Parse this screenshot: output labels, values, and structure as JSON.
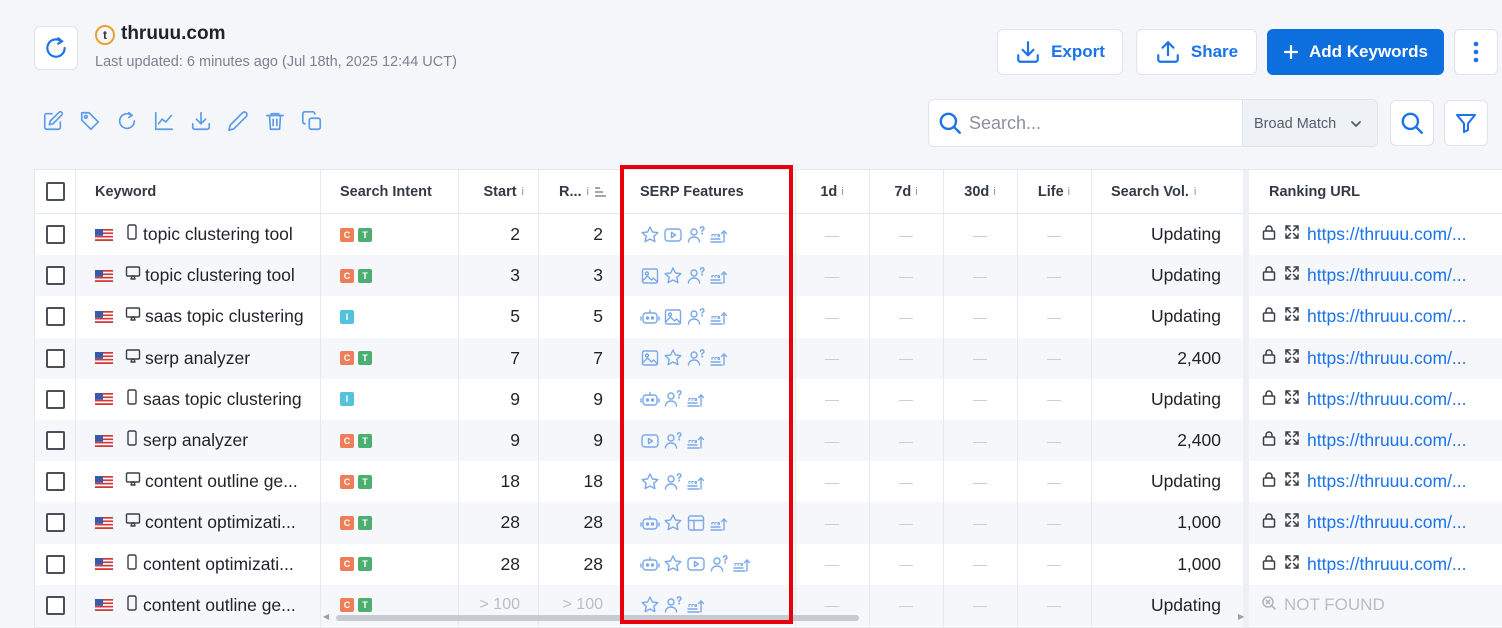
{
  "header": {
    "site_logo": "t",
    "site_title": "thruuu.com",
    "last_updated": "Last updated: 6 minutes ago (Jul 18th, 2025 12:44 UCT)",
    "export_label": "Export",
    "share_label": "Share",
    "add_label": "Add Keywords"
  },
  "search": {
    "placeholder": "Search...",
    "match_type": "Broad Match"
  },
  "table": {
    "columns": {
      "keyword": "Keyword",
      "intent": "Search Intent",
      "start": "Start",
      "rank": "R...",
      "serp": "SERP Features",
      "d1": "1d",
      "d7": "7d",
      "d30": "30d",
      "life": "Life",
      "volume": "Search Vol.",
      "url": "Ranking URL"
    },
    "info_mark": "i",
    "dash": "—",
    "rows": [
      {
        "keyword": "topic clustering tool",
        "device": "mobile",
        "intents": [
          "C",
          "T"
        ],
        "start": "2",
        "rank": "2",
        "serp": [
          "star",
          "video",
          "people",
          "sitelinks"
        ],
        "volume": "Updating",
        "url": "https://thruuu.com/..."
      },
      {
        "keyword": "topic clustering tool",
        "device": "desktop",
        "intents": [
          "C",
          "T"
        ],
        "start": "3",
        "rank": "3",
        "serp": [
          "image",
          "star",
          "people",
          "sitelinks"
        ],
        "volume": "Updating",
        "url": "https://thruuu.com/..."
      },
      {
        "keyword": "saas topic clustering",
        "device": "desktop",
        "intents": [
          "I"
        ],
        "start": "5",
        "rank": "5",
        "serp": [
          "ai",
          "image",
          "people",
          "sitelinks"
        ],
        "volume": "Updating",
        "url": "https://thruuu.com/..."
      },
      {
        "keyword": "serp analyzer",
        "device": "desktop",
        "intents": [
          "C",
          "T"
        ],
        "start": "7",
        "rank": "7",
        "serp": [
          "image",
          "star",
          "people",
          "sitelinks"
        ],
        "volume": "2,400",
        "url": "https://thruuu.com/..."
      },
      {
        "keyword": "saas topic clustering",
        "device": "mobile",
        "intents": [
          "I"
        ],
        "start": "9",
        "rank": "9",
        "serp": [
          "ai",
          "people",
          "sitelinks"
        ],
        "volume": "Updating",
        "url": "https://thruuu.com/..."
      },
      {
        "keyword": "serp analyzer",
        "device": "mobile",
        "intents": [
          "C",
          "T"
        ],
        "start": "9",
        "rank": "9",
        "serp": [
          "video",
          "people",
          "sitelinks"
        ],
        "volume": "2,400",
        "url": "https://thruuu.com/..."
      },
      {
        "keyword": "content outline ge...",
        "device": "desktop",
        "intents": [
          "C",
          "T"
        ],
        "start": "18",
        "rank": "18",
        "serp": [
          "star",
          "people",
          "sitelinks"
        ],
        "volume": "Updating",
        "url": "https://thruuu.com/..."
      },
      {
        "keyword": "content optimizati...",
        "device": "desktop",
        "intents": [
          "C",
          "T"
        ],
        "start": "28",
        "rank": "28",
        "serp": [
          "ai",
          "star",
          "panel",
          "sitelinks"
        ],
        "volume": "1,000",
        "url": "https://thruuu.com/..."
      },
      {
        "keyword": "content optimizati...",
        "device": "mobile",
        "intents": [
          "C",
          "T"
        ],
        "start": "28",
        "rank": "28",
        "serp": [
          "ai",
          "star",
          "video",
          "people",
          "sitelinks"
        ],
        "volume": "1,000",
        "url": "https://thruuu.com/..."
      },
      {
        "keyword": "content outline ge...",
        "device": "mobile",
        "intents": [
          "C",
          "T"
        ],
        "start": "> 100",
        "rank": "> 100",
        "serp": [
          "star",
          "people",
          "sitelinks"
        ],
        "volume": "Updating",
        "url": "NOT FOUND"
      }
    ]
  },
  "colors": {
    "accent": "#1a73e8",
    "primary_button": "#0d6fdd",
    "commercial_badge": "#ef7e58",
    "transactional_badge": "#4caf71",
    "informational_badge": "#55c2dc",
    "highlight_box": "#e8000b"
  }
}
